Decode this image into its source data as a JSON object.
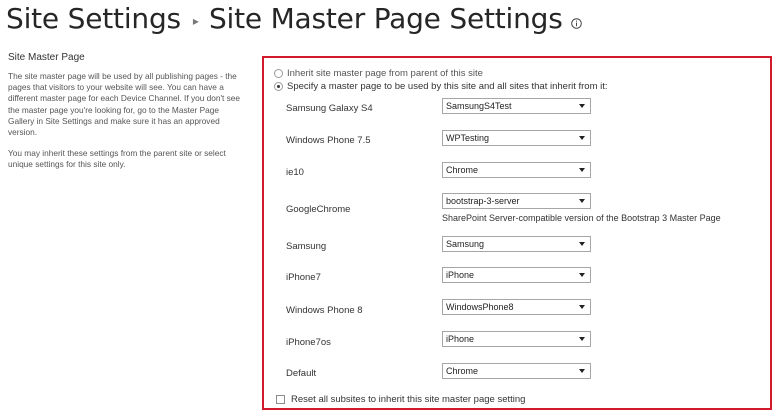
{
  "header": {
    "crumb_root": "Site Settings",
    "crumb_separator": "▸",
    "crumb_current": "Site Master Page Settings",
    "info_icon": "info-icon"
  },
  "description": {
    "title": "Site Master Page",
    "paragraph1": "The site master page will be used by all publishing pages - the pages that visitors to your website will see. You can have a different master page for each Device Channel. If you don't see the master page you're looking for, go to the Master Page Gallery in Site Settings and make sure it has an approved version.",
    "paragraph2": "You may inherit these settings from the parent site or select unique settings for this site only."
  },
  "options": {
    "inherit_label": "Inherit site master page from parent of this site",
    "inherit_selected": false,
    "specify_label": "Specify a master page to be used by this site and all sites that inherit from it:",
    "specify_selected": true
  },
  "channels": [
    {
      "name": "Samsung Galaxy S4",
      "master_page": "SamsungS4Test"
    },
    {
      "name": "Windows Phone 7.5",
      "master_page": "WPTesting"
    },
    {
      "name": "ie10",
      "master_page": "Chrome"
    },
    {
      "name": "GoogleChrome",
      "master_page": "bootstrap-3-server",
      "description": "SharePoint Server-compatible version of the Bootstrap 3 Master Page"
    },
    {
      "name": "Samsung",
      "master_page": "Samsung"
    },
    {
      "name": "iPhone7",
      "master_page": "iPhone"
    },
    {
      "name": "Windows Phone 8",
      "master_page": "WindowsPhone8"
    },
    {
      "name": "iPhone7os",
      "master_page": "iPhone"
    },
    {
      "name": "Default",
      "master_page": "Chrome"
    }
  ],
  "reset": {
    "label": "Reset all subsites to inherit this site master page setting",
    "checked": false
  },
  "colors": {
    "highlight_border": "#d21a2a"
  }
}
